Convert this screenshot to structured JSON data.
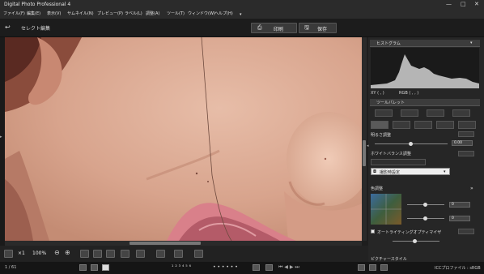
{
  "app": {
    "title": "Digital Photo Professional 4"
  },
  "menu": [
    "ファイル(F)",
    "編集(E)",
    "表示(V)",
    "サムネイル(N)",
    "プレビュー(P)",
    "ラベル(L)",
    "調整(A)",
    "ツール(T)",
    "ウィンドウ(W)",
    "ヘルプ(H)"
  ],
  "toolbar": {
    "back_label": "セレクト編集",
    "print_label": "印刷",
    "save_label": "保存"
  },
  "viewer": {
    "zoom_label": "×1",
    "zoom_percent": "100%"
  },
  "status": {
    "page_counter": "1 / 61",
    "color_profile": "ICCプロファイル : sRGB"
  },
  "panel": {
    "histogram_title": "ヒストグラム",
    "xy_label": "XY ( , )",
    "rgb_label": "RGB ( , , )",
    "tool_palette_title": "ツールパレット",
    "brightness_label": "明るさ調整",
    "brightness_value": "0.00",
    "wb_label": "ホワイトバランス調整",
    "wb_select_value": "撮影時設定",
    "color_label": "色調整",
    "tone_value_1": "0",
    "tone_value_2": "0",
    "auto_lighting_label": "オートライティングオプティマイザ",
    "picture_style_label": "ピクチャースタイル"
  },
  "colors": {
    "accent": "#4a4a4a",
    "panel_bg": "#262626",
    "skin": "#d9a892"
  }
}
